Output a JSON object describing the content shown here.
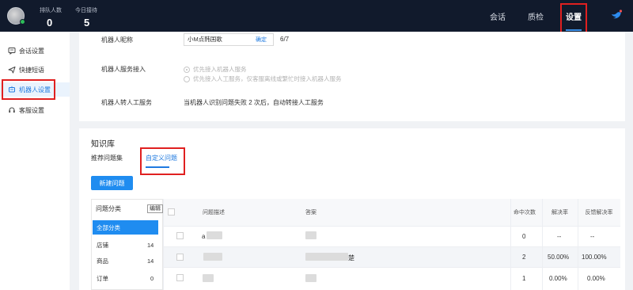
{
  "topbar": {
    "queue_label": "排队人数",
    "queue_value": "0",
    "today_label": "今日接待",
    "today_value": "5",
    "nav": [
      "会话",
      "质检",
      "设置"
    ]
  },
  "sidebar": {
    "items": [
      {
        "label": "会话设置",
        "icon": "chat-settings-icon"
      },
      {
        "label": "快捷短语",
        "icon": "send-icon"
      },
      {
        "label": "机器人设置",
        "icon": "robot-icon"
      },
      {
        "label": "客服设置",
        "icon": "headset-icon"
      }
    ]
  },
  "robot": {
    "nickname_label": "机器人昵称",
    "nickname_value": "小M点韩国歌",
    "confirm_label": "确定",
    "nickname_count": "6/7",
    "access_label": "机器人服务接入",
    "access_options": [
      "优先接入机器人服务",
      "优先接入人工服务，仅客服离线或繁忙时接入机器人服务"
    ],
    "transfer_label": "机器人转人工服务",
    "transfer_text": "当机器人识别问题失败 2 次后，自动转接人工服务"
  },
  "kb": {
    "title": "知识库",
    "tabs": [
      "推荐问题集",
      "自定义问题"
    ],
    "new_button": "新建问题",
    "category_header": "问题分类",
    "edit_label": "编辑",
    "categories": [
      {
        "name": "全部分类",
        "count": ""
      },
      {
        "name": "店铺",
        "count": "14"
      },
      {
        "name": "商品",
        "count": "14"
      },
      {
        "name": "订单",
        "count": "0"
      }
    ],
    "columns": [
      "问题描述",
      "答案",
      "命中次数",
      "解决率",
      "反馈解决率"
    ],
    "rows": [
      {
        "desc": "a",
        "answer": "",
        "hits": "0",
        "rate": "--",
        "fb_rate": "--"
      },
      {
        "desc": "",
        "answer": "楚",
        "hits": "2",
        "rate": "50.00%",
        "fb_rate": "100.00%"
      },
      {
        "desc": "",
        "answer": "",
        "hits": "1",
        "rate": "0.00%",
        "fb_rate": "0.00%"
      }
    ]
  }
}
